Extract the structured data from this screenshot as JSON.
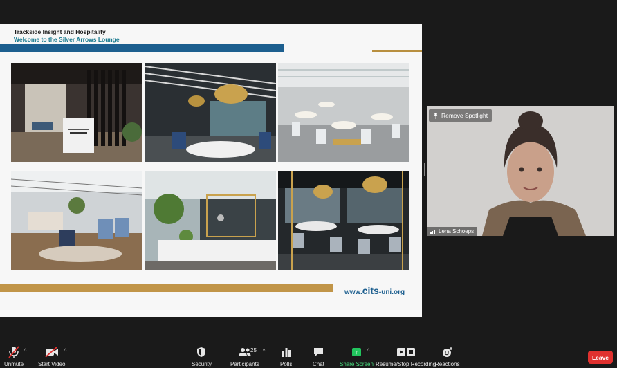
{
  "slide": {
    "title": "Trackside Insight and Hospitality",
    "subtitle": "Welcome to the Silver Arrows Lounge",
    "footer_site_prefix": "www.",
    "footer_site_brand": "cits",
    "footer_site_suffix": "-uni.org",
    "colors": {
      "blue_bar": "#1d5f8f",
      "gold_bar": "#c19548",
      "subtitle": "#1a7a8f"
    }
  },
  "video": {
    "spotlight_label": "Remove Spotlight",
    "participant_name": "Lena Schoeps"
  },
  "toolbar": {
    "unmute_label": "Unmute",
    "start_video_label": "Start Video",
    "security_label": "Security",
    "participants_label": "Participants",
    "participants_count": "25",
    "polls_label": "Polls",
    "chat_label": "Chat",
    "share_label": "Share Screen",
    "recording_label": "Resume/Stop Recording",
    "reactions_label": "Reactions",
    "leave_label": "Leave",
    "colors": {
      "leave": "#e0312f",
      "share": "#22c55e"
    }
  }
}
